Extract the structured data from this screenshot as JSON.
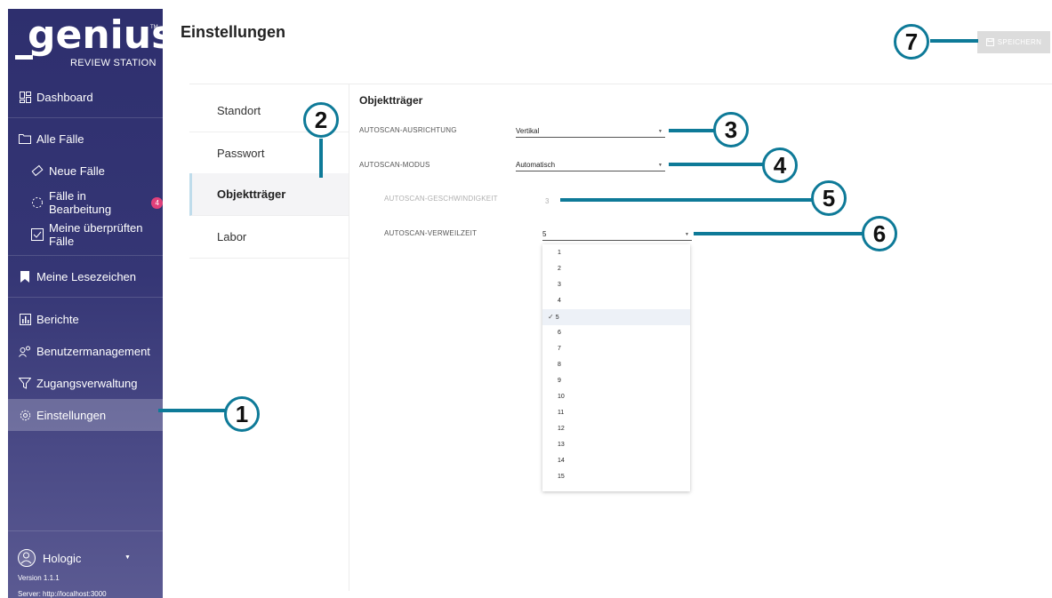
{
  "app": {
    "logo_text": "genius",
    "logo_tm": "TM",
    "logo_subtitle": "REVIEW STATION"
  },
  "sidebar": {
    "items": [
      {
        "label": "Dashboard",
        "icon": "dashboard-icon"
      },
      {
        "label": "Alle Fälle",
        "icon": "folder-icon"
      },
      {
        "label": "Neue Fälle",
        "icon": "slide-icon"
      },
      {
        "label": "Fälle in Bearbeitung",
        "icon": "progress-icon",
        "badge": "4"
      },
      {
        "label": "Meine überprüften Fälle",
        "icon": "checkbox-icon"
      },
      {
        "label": "Meine Lesezeichen",
        "icon": "bookmark-icon"
      },
      {
        "label": "Berichte",
        "icon": "reports-icon"
      },
      {
        "label": "Benutzermanagement",
        "icon": "users-icon"
      },
      {
        "label": "Zugangsverwaltung",
        "icon": "access-icon"
      },
      {
        "label": "Einstellungen",
        "icon": "gear-icon",
        "active": true
      }
    ],
    "user_name": "Hologic",
    "version": "Version 1.1.1",
    "server": "Server: http://localhost:3000"
  },
  "header": {
    "title": "Einstellungen",
    "save_label": "SPEICHERN"
  },
  "tabs": [
    "Standort",
    "Passwort",
    "Objektträger",
    "Labor"
  ],
  "active_tab": "Objektträger",
  "content": {
    "section_title": "Objektträger",
    "fields": [
      {
        "label": "AUTOSCAN-AUSRICHTUNG",
        "value": "Vertikal",
        "type": "select"
      },
      {
        "label": "AUTOSCAN-MODUS",
        "value": "Automatisch",
        "type": "select"
      },
      {
        "label": "AUTOSCAN-GESCHWINDIGKEIT",
        "value": "3",
        "type": "static",
        "disabled": true
      },
      {
        "label": "AUTOSCAN-VERWEILZEIT",
        "value": "5",
        "type": "select",
        "open": true
      }
    ],
    "dropdown_options": [
      "1",
      "2",
      "3",
      "4",
      "5",
      "6",
      "7",
      "8",
      "9",
      "10",
      "11",
      "12",
      "13",
      "14",
      "15"
    ],
    "dropdown_selected": "5"
  },
  "callouts": [
    "1",
    "2",
    "3",
    "4",
    "5",
    "6",
    "7"
  ],
  "colors": {
    "sidebar": "#2e2f6e",
    "callout": "#0e7a98",
    "badge": "#e0407a"
  }
}
